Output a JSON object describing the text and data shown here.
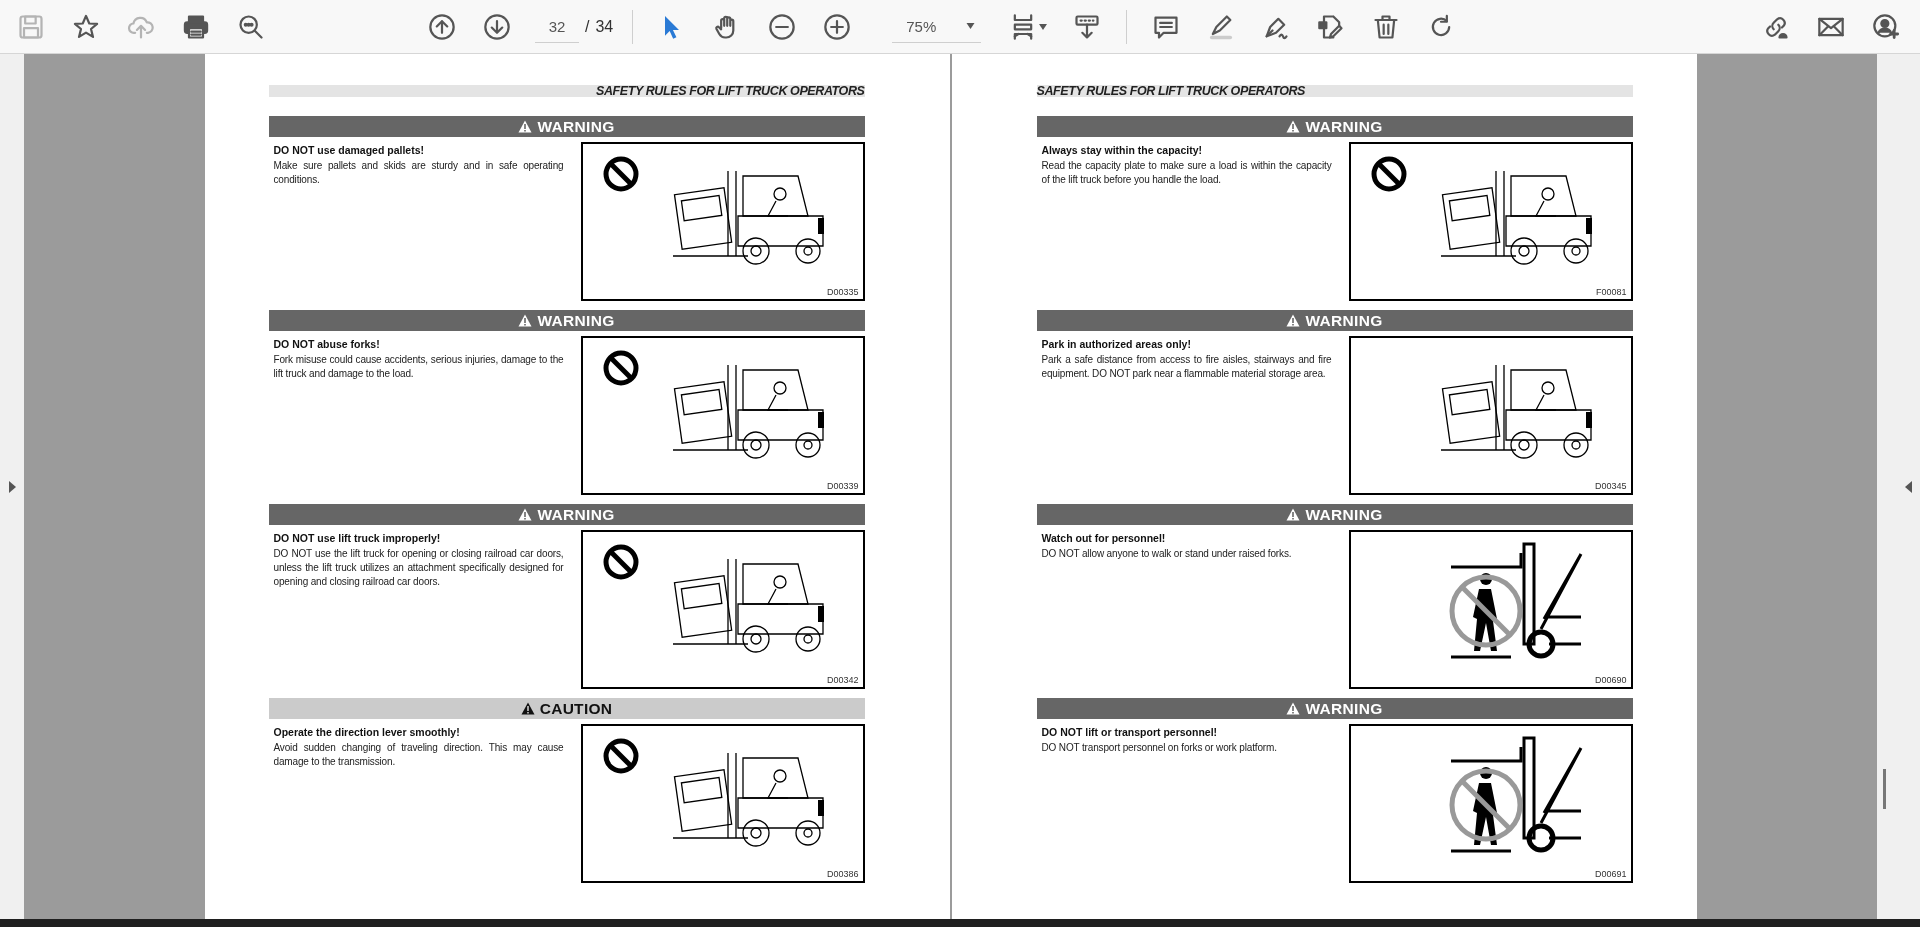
{
  "toolbar": {
    "file_tools": [
      {
        "kind": "save",
        "disabled": true
      },
      {
        "kind": "bookmark",
        "disabled": false
      },
      {
        "kind": "upload",
        "disabled": true
      },
      {
        "kind": "print",
        "disabled": false
      },
      {
        "kind": "find",
        "disabled": false
      }
    ],
    "nav_buttons": [
      {
        "kind": "previous"
      },
      {
        "kind": "next"
      }
    ],
    "page_field": {
      "value": "32"
    },
    "page_separator": "/",
    "page_total": "34",
    "select_tools": [
      {
        "kind": "pointer",
        "selected": true
      },
      {
        "kind": "hand",
        "selected": false
      }
    ],
    "zoom_buttons": [
      {
        "kind": "zoom-out"
      },
      {
        "kind": "zoom-in"
      }
    ],
    "zoom_field": {
      "value": "75%"
    },
    "view_tools": [
      {
        "kind": "fit",
        "dropdown": true
      },
      {
        "kind": "scroll-mode",
        "dropdown": false
      }
    ],
    "annotate_tools": [
      {
        "kind": "comment"
      },
      {
        "kind": "highlight"
      },
      {
        "kind": "sign"
      },
      {
        "kind": "edit"
      },
      {
        "kind": "delete"
      },
      {
        "kind": "rotate"
      }
    ],
    "share_tools": [
      {
        "kind": "link"
      },
      {
        "kind": "mail"
      },
      {
        "kind": "add-user"
      }
    ]
  },
  "pages": [
    {
      "kind": "left",
      "header": "SAFETY RULES FOR LIFT TRUCK OPERATORS",
      "sections": [
        {
          "kind": "warning",
          "label": "WARNING",
          "title": "DO NOT use damaged pallets!",
          "body": "Make sure pallets and skids are sturdy and in safe operating conditions.",
          "figure": {
            "kind": "scene",
            "prohibited": true,
            "code": "D00335"
          }
        },
        {
          "kind": "warning",
          "label": "WARNING",
          "title": "DO NOT abuse forks!",
          "body": "Fork misuse could cause accidents, serious injuries, damage to the lift truck and damage to the load.",
          "figure": {
            "kind": "scene",
            "prohibited": true,
            "code": "D00339"
          }
        },
        {
          "kind": "warning",
          "label": "WARNING",
          "title": "DO NOT use lift truck improperly!",
          "body": "DO NOT use the lift truck for opening or closing railroad car doors, unless the lift truck utilizes an attachment specifically designed for opening and closing railroad car doors.",
          "figure": {
            "kind": "scene",
            "prohibited": true,
            "code": "D00342"
          }
        },
        {
          "kind": "caution",
          "label": "CAUTION",
          "title": "Operate the direction lever smoothly!",
          "body": "Avoid sudden changing of traveling direction. This may cause damage to the transmission.",
          "figure": {
            "kind": "scene",
            "prohibited": true,
            "code": "D00386"
          }
        }
      ]
    },
    {
      "kind": "right",
      "header": "SAFETY RULES FOR LIFT TRUCK OPERATORS",
      "sections": [
        {
          "kind": "warning",
          "label": "WARNING",
          "title": "Always stay within the capacity!",
          "body": "Read the capacity plate to make sure a load is within the capacity of the lift truck before you handle the load.",
          "figure": {
            "kind": "scene",
            "prohibited": true,
            "code": "F00081"
          }
        },
        {
          "kind": "warning",
          "label": "WARNING",
          "title": "Park in authorized areas only!",
          "body": "Park a safe distance from access to fire aisles, stairways and fire equipment. DO NOT park near a flammable material storage area.",
          "figure": {
            "kind": "scene",
            "prohibited": false,
            "code": "D00345"
          }
        },
        {
          "kind": "warning",
          "label": "WARNING",
          "title": "Watch out for personnel!",
          "body": "DO NOT allow anyone to walk or stand under raised forks.",
          "figure": {
            "kind": "pictogram",
            "prohibited": true,
            "code": "D00690"
          }
        },
        {
          "kind": "warning",
          "label": "WARNING",
          "title": "DO NOT lift or transport personnel!",
          "body": "DO NOT transport personnel on forks or work platform.",
          "figure": {
            "kind": "pictogram",
            "prohibited": true,
            "code": "D00691"
          }
        }
      ]
    }
  ]
}
